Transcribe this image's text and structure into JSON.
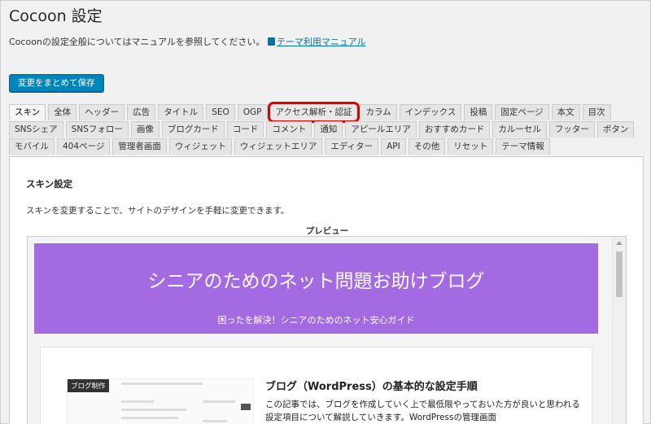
{
  "page": {
    "title": "Cocoon 設定",
    "intro_text": "Cocoonの設定全般についてはマニュアルを参照してください。",
    "manual_link": "テーマ利用マニュアル",
    "save_button": "変更をまとめて保存"
  },
  "tabs": {
    "rows": [
      [
        {
          "label": "スキン",
          "active": true
        },
        {
          "label": "全体"
        },
        {
          "label": "ヘッダー"
        },
        {
          "label": "広告"
        },
        {
          "label": "タイトル"
        },
        {
          "label": "SEO"
        },
        {
          "label": "OGP"
        },
        {
          "label": "アクセス解析・認証",
          "highlighted": true
        },
        {
          "label": "カラム"
        },
        {
          "label": "インデックス"
        },
        {
          "label": "投稿"
        },
        {
          "label": "固定ページ"
        },
        {
          "label": "本文"
        },
        {
          "label": "目次"
        }
      ],
      [
        {
          "label": "SNSシェア"
        },
        {
          "label": "SNSフォロー"
        },
        {
          "label": "画像"
        },
        {
          "label": "ブログカード"
        },
        {
          "label": "コード"
        },
        {
          "label": "コメント"
        },
        {
          "label": "通知"
        },
        {
          "label": "アピールエリア"
        },
        {
          "label": "おすすめカード"
        },
        {
          "label": "カルーセル"
        },
        {
          "label": "フッター"
        },
        {
          "label": "ボタン"
        }
      ],
      [
        {
          "label": "モバイル"
        },
        {
          "label": "404ページ"
        },
        {
          "label": "管理者画面"
        },
        {
          "label": "ウィジェット"
        },
        {
          "label": "ウィジェットエリア"
        },
        {
          "label": "エディター"
        },
        {
          "label": "API"
        },
        {
          "label": "その他"
        },
        {
          "label": "リセット"
        },
        {
          "label": "テーマ情報"
        }
      ]
    ]
  },
  "panel": {
    "heading": "スキン設定",
    "description": "スキンを変更することで、サイトのデザインを手軽に変更できます。",
    "preview_label": "プレビュー"
  },
  "preview": {
    "site_title": "シニアのためのネット問題お助けブログ",
    "site_tagline": "困ったを解決！シニアのためのネット安心ガイド",
    "thumb_badge": "ブログ制作",
    "post_title": "ブログ（WordPress）の基本的な設定手順",
    "post_excerpt": "この記事では、ブログを作成していく上で最低限やっておいた方が良いと思われる設定項目について解説していきます。WordPressの管理画面"
  },
  "colors": {
    "header_purple": "#a36ae1",
    "primary_button": "#0085ba",
    "highlight_red": "#e00000"
  }
}
